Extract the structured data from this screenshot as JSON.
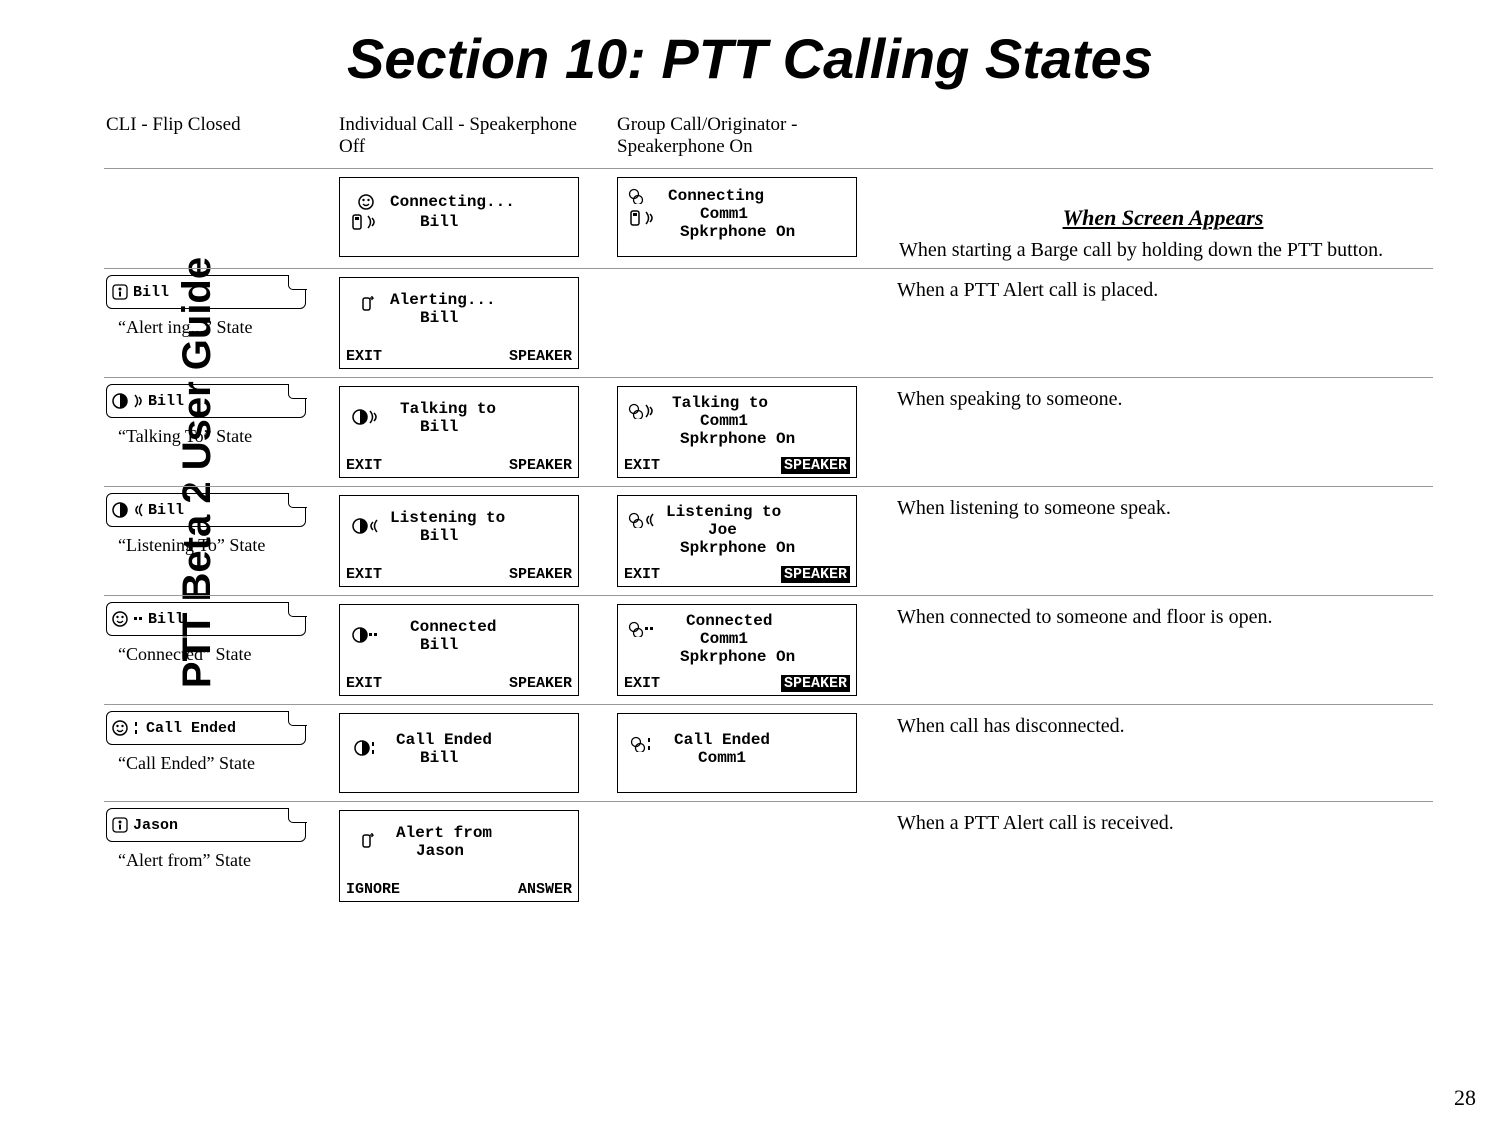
{
  "sidebar": "PTT Beta 2 User Guide",
  "title": "Section 10: PTT Calling States",
  "page_num": "28",
  "headers": {
    "col1": "CLI - Flip Closed",
    "col2": "Individual Call -  Speakerphone Off",
    "col3": "Group Call/Originator - Speakerphone On",
    "col4": "When Screen Appears"
  },
  "rows": [
    {
      "closed_name": "",
      "state_label": "",
      "screen_ind": {
        "l1": "Connecting...",
        "l2": "Bill",
        "sk_l": "",
        "sk_r": ""
      },
      "screen_grp": {
        "l1": "Connecting",
        "l2": "Comm1",
        "l3": "Spkrphone On",
        "sk_l": "",
        "sk_r": ""
      },
      "desc": "When starting a Barge call by holding down the PTT button."
    },
    {
      "closed_name": "Bill",
      "state_label": "“Alert ing...” State",
      "screen_ind": {
        "l1": "Alerting...",
        "l2": "Bill",
        "sk_l": "EXIT",
        "sk_r": "SPEAKER"
      },
      "desc": "When a PTT Alert call is placed."
    },
    {
      "closed_name": "Bill",
      "state_label": "“Talking To” State",
      "screen_ind": {
        "l1": "Talking to",
        "l2": "Bill",
        "sk_l": "EXIT",
        "sk_r": "SPEAKER"
      },
      "screen_grp": {
        "l1": "Talking to",
        "l2": "Comm1",
        "l3": "Spkrphone On",
        "sk_l": "EXIT",
        "sk_r": "SPEAKER",
        "sk_r_inv": true
      },
      "desc": "When speaking to someone."
    },
    {
      "closed_name": "Bill",
      "state_label": "“Listening To” State",
      "screen_ind": {
        "l1": "Listening to",
        "l2": "Bill",
        "sk_l": "EXIT",
        "sk_r": "SPEAKER"
      },
      "screen_grp": {
        "l1": "Listening to",
        "l2": "Joe",
        "l3": "Spkrphone On",
        "sk_l": "EXIT",
        "sk_r": "SPEAKER",
        "sk_r_inv": true
      },
      "desc": "When listening to someone speak."
    },
    {
      "closed_name": "Bill",
      "state_label": "“Connected” State",
      "screen_ind": {
        "l1": "Connected",
        "l2": "Bill",
        "sk_l": "EXIT",
        "sk_r": "SPEAKER"
      },
      "screen_grp": {
        "l1": "Connected",
        "l2": "Comm1",
        "l3": "Spkrphone On",
        "sk_l": "EXIT",
        "sk_r": "SPEAKER",
        "sk_r_inv": true
      },
      "desc": "When connected to someone and floor is open."
    },
    {
      "closed_name": "Call Ended",
      "state_label": "“Call Ended” State",
      "screen_ind": {
        "l1": "Call Ended",
        "l2": "Bill",
        "sk_l": "",
        "sk_r": ""
      },
      "screen_grp": {
        "l1": "Call Ended",
        "l2": "Comm1",
        "sk_l": "",
        "sk_r": ""
      },
      "desc": "When call has disconnected."
    },
    {
      "closed_name": "Jason",
      "state_label": "“Alert from” State",
      "screen_ind": {
        "l1": "Alert from",
        "l2": "Jason",
        "sk_l": "IGNORE",
        "sk_r": "ANSWER"
      },
      "desc": "When a PTT Alert call is received."
    }
  ]
}
